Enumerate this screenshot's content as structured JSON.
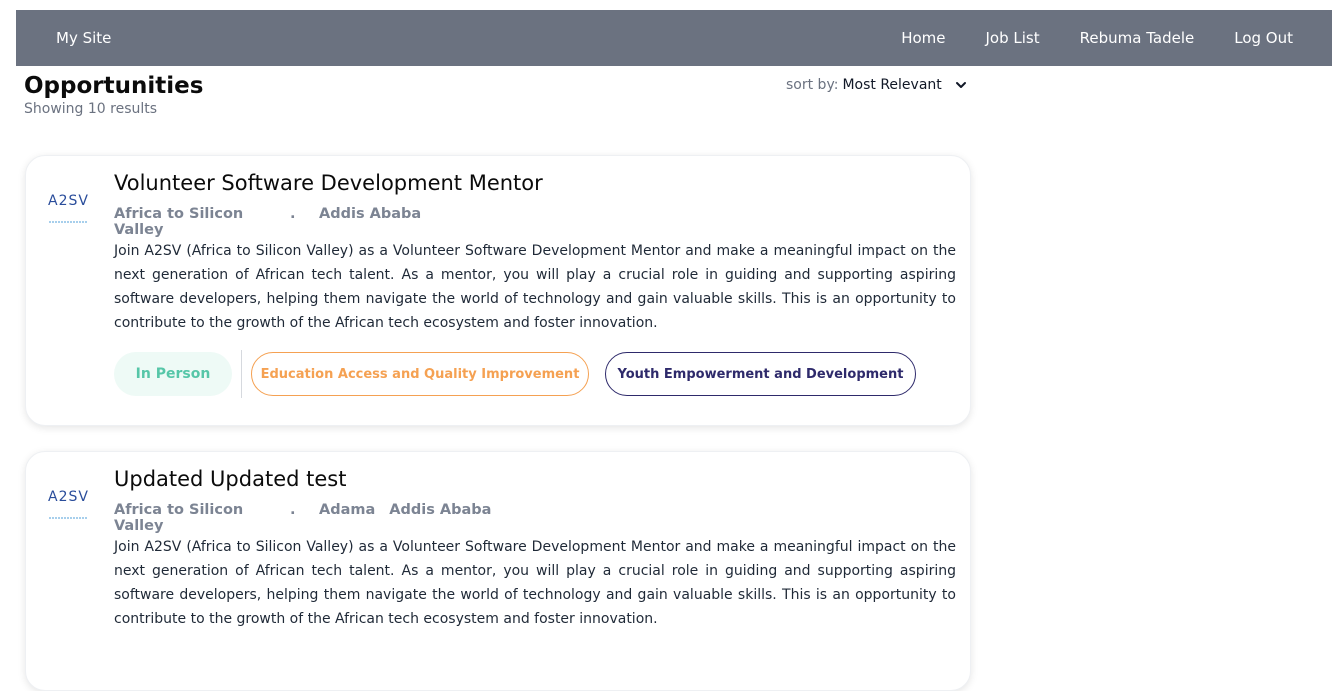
{
  "navbar": {
    "brand": "My Site",
    "links": [
      "Home",
      "Job List",
      "Rebuma Tadele",
      "Log Out"
    ]
  },
  "header": {
    "title": "Opportunities",
    "result_count": "Showing 10 results",
    "sort_label": "sort by:",
    "sort_value": "Most Relevant"
  },
  "cards": [
    {
      "logo_text": "A2SV",
      "title": "Volunteer Software Development Mentor",
      "org": "Africa to Silicon Valley",
      "separator": ".",
      "locations": [
        "Addis Ababa"
      ],
      "description": "Join A2SV (Africa to Silicon Valley) as a Volunteer Software Development Mentor and make a meaningful impact on the next generation of African tech talent. As a mentor, you will play a crucial role in guiding and supporting aspiring software developers, helping them navigate the world of technology and gain valuable skills. This is an opportunity to contribute to the growth of the African tech ecosystem and foster innovation.",
      "tags": [
        "In Person",
        "Education Access and Quality Improvement",
        "Youth Empowerment and Development"
      ]
    },
    {
      "logo_text": "A2SV",
      "title": "Updated Updated test",
      "org": "Africa to Silicon Valley",
      "separator": ".",
      "locations": [
        "Adama",
        "Addis Ababa"
      ],
      "description": "Join A2SV (Africa to Silicon Valley) as a Volunteer Software Development Mentor and make a meaningful impact on the next generation of African tech talent. As a mentor, you will play a crucial role in guiding and supporting aspiring software developers, helping them navigate the world of technology and gain valuable skills. This is an opportunity to contribute to the growth of the African tech ecosystem and foster innovation."
    }
  ],
  "colors": {
    "navbar_bg": "#6b7280",
    "in_person": "#56c6a8",
    "education_tag": "#f5a152",
    "youth_tag": "#2e2a6b"
  },
  "icons": {
    "sort_dropdown": "chevron-down-icon",
    "company_logo": "a2sv-logo"
  }
}
